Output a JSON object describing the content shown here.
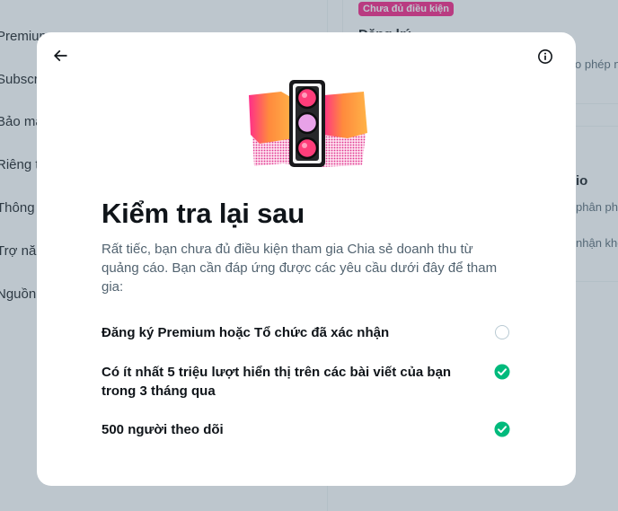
{
  "background": {
    "sidebar_items": [
      "Premium",
      "Subscriptions",
      "Bảo mật",
      "Riêng tư",
      "Thông báo",
      "Trợ năng",
      "Nguồn"
    ],
    "badge": "Chưa đủ điều kiện",
    "right_texts": [
      "Đăng ký",
      "o phép n",
      "io",
      "phân ph",
      "nhận kho"
    ]
  },
  "modal": {
    "back_icon": "arrow-left-icon",
    "info_icon": "info-circle-icon",
    "illustration": "traffic-light-illustration",
    "title": "Kiểm tra lại sau",
    "description": "Rất tiếc, bạn chưa đủ điều kiện tham gia Chia sẻ doanh thu từ quảng cáo. Bạn cần đáp ứng được các yêu cầu dưới đây để tham gia:",
    "requirements": [
      {
        "label": "Đăng ký Premium hoặc Tổ chức đã xác nhận",
        "met": false
      },
      {
        "label": "Có ít nhất 5 triệu lượt hiển thị trên các bài viết của bạn trong 3 tháng qua",
        "met": true
      },
      {
        "label": "500 người theo dõi",
        "met": true
      }
    ]
  },
  "colors": {
    "success": "#00ba7c",
    "badge": "#f91880",
    "overlay": "rgba(91,112,131,0.4)"
  }
}
